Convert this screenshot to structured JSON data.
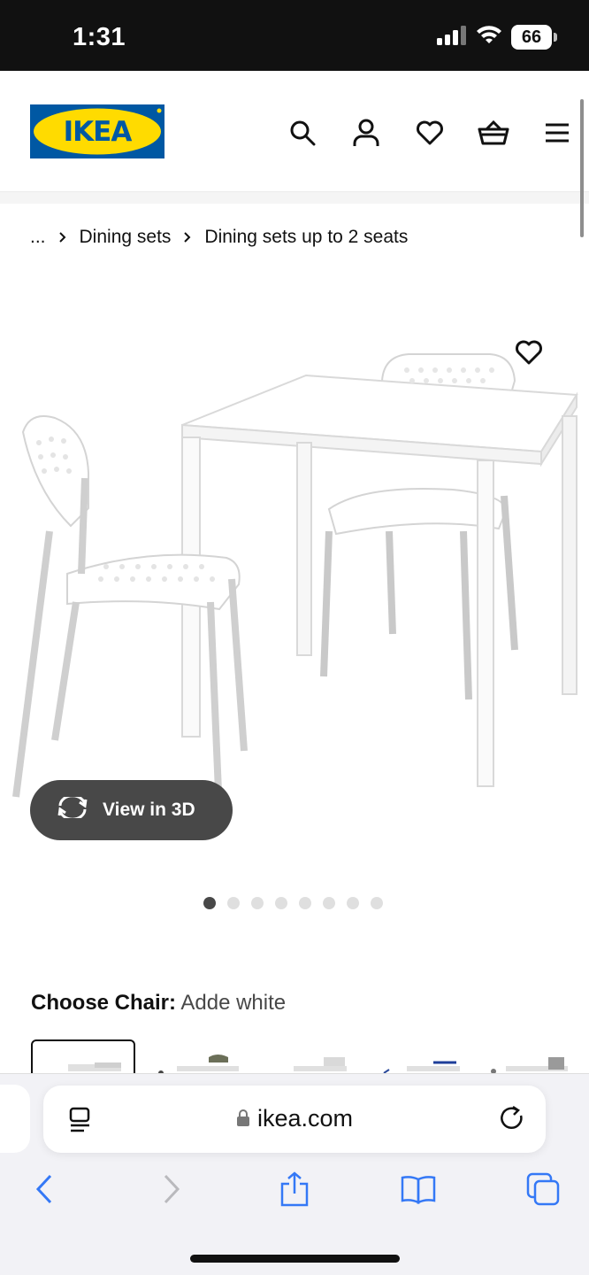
{
  "status_bar": {
    "time": "1:31",
    "battery": "66"
  },
  "header": {
    "logo_text": "IKEA",
    "icons": [
      "search-icon",
      "account-icon",
      "favourites-icon",
      "cart-icon",
      "menu-icon"
    ]
  },
  "breadcrumb": {
    "ellipsis": "...",
    "items": [
      "Dining sets",
      "Dining sets up to 2 seats"
    ]
  },
  "product": {
    "view_3d_label": "View in 3D",
    "carousel": {
      "count": 8,
      "active_index": 0
    },
    "choose_label": "Choose Chair:",
    "choose_value": "Adde white"
  },
  "browser": {
    "url": "ikea.com"
  },
  "colors": {
    "ikea_blue": "#0058a3",
    "ikea_yellow": "#ffdb00",
    "dark_pill": "#484848"
  }
}
